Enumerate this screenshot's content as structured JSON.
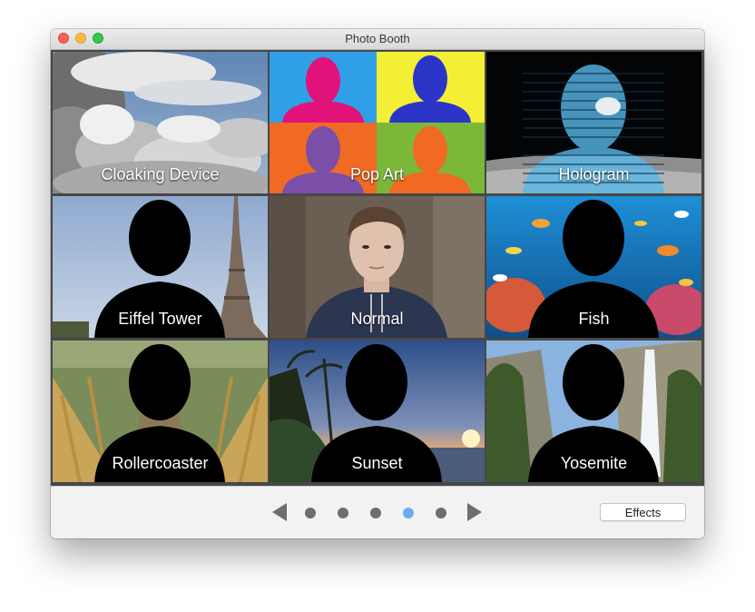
{
  "window": {
    "title": "Photo Booth"
  },
  "effects": [
    {
      "label": "Cloaking Device"
    },
    {
      "label": "Pop Art"
    },
    {
      "label": "Hologram"
    },
    {
      "label": "Eiffel Tower"
    },
    {
      "label": "Normal"
    },
    {
      "label": "Fish"
    },
    {
      "label": "Rollercoaster"
    },
    {
      "label": "Sunset"
    },
    {
      "label": "Yosemite"
    }
  ],
  "pager": {
    "page_count": 5,
    "current_page": 4
  },
  "toolbar": {
    "effects_button": "Effects"
  }
}
